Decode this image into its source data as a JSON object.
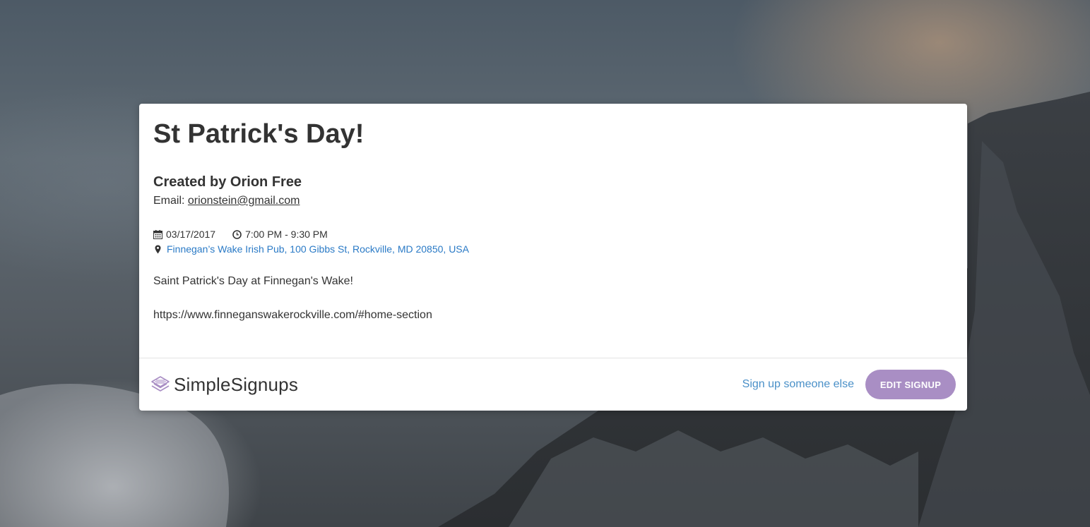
{
  "event": {
    "title": "St Patrick's Day!",
    "creator_line": "Created by Orion Free",
    "email_label": "Email: ",
    "email": "orionstein@gmail.com",
    "date": "03/17/2017",
    "time": "7:00 PM - 9:30 PM",
    "location": "Finnegan’s Wake Irish Pub, 100 Gibbs St, Rockville, MD 20850, USA",
    "description": "Saint Patrick's Day at Finnegan's Wake!",
    "link": "https://www.finneganswakerockville.com/#home-section"
  },
  "footer": {
    "brand_name": "SimpleSignups",
    "signup_else_label": "Sign up someone else",
    "edit_button_label": "EDIT SIGNUP"
  },
  "colors": {
    "accent_purple": "#a98ec4",
    "link_blue": "#2a7ac6",
    "secondary_link": "#4a90c8",
    "text_dark": "#333333"
  },
  "icons": {
    "date": "calendar-icon",
    "time": "clock-icon",
    "location": "map-marker-icon",
    "brand": "stacked-layers-logo-icon"
  }
}
